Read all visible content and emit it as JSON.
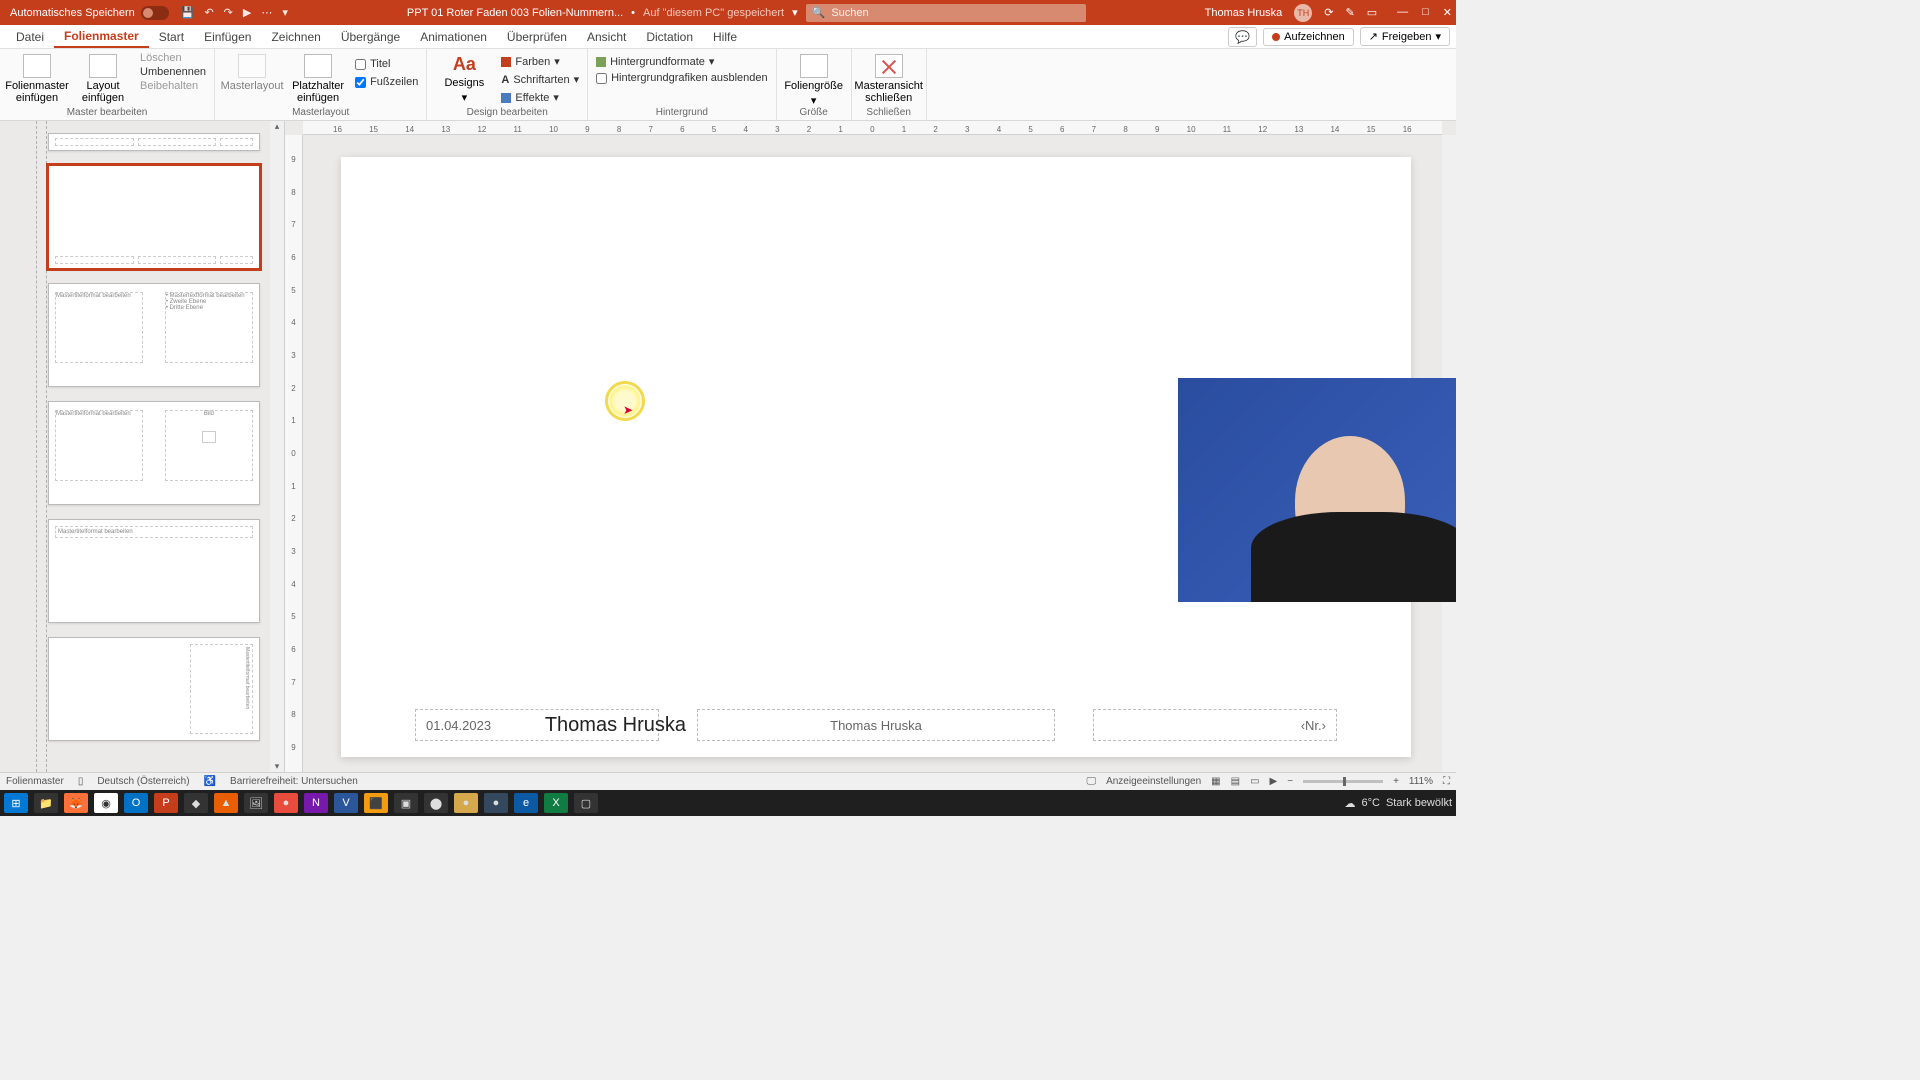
{
  "titlebar": {
    "autosave_label": "Automatisches Speichern",
    "filename": "PPT 01 Roter Faden 003 Folien-Nummern...",
    "saved_location": "Auf \"diesem PC\" gespeichert",
    "search_placeholder": "Suchen",
    "user_name": "Thomas Hruska",
    "user_initials": "TH"
  },
  "tabs": {
    "items": [
      "Datei",
      "Folienmaster",
      "Start",
      "Einfügen",
      "Zeichnen",
      "Übergänge",
      "Animationen",
      "Überprüfen",
      "Ansicht",
      "Dictation",
      "Hilfe"
    ],
    "active_index": 1,
    "record_label": "Aufzeichnen",
    "share_label": "Freigeben"
  },
  "ribbon": {
    "group_edit": {
      "insert_master": "Folienmaster einfügen",
      "insert_layout": "Layout einfügen",
      "delete": "Löschen",
      "rename": "Umbenennen",
      "preserve": "Beibehalten",
      "label": "Master bearbeiten"
    },
    "group_layout": {
      "master_layout": "Masterlayout",
      "placeholder": "Platzhalter einfügen",
      "title_chk": "Titel",
      "footer_chk": "Fußzeilen",
      "label": "Masterlayout"
    },
    "group_design": {
      "designs": "Designs",
      "colors": "Farben",
      "fonts": "Schriftarten",
      "effects": "Effekte",
      "label": "Design bearbeiten"
    },
    "group_bg": {
      "bg_formats": "Hintergrundformate",
      "hide_bg": "Hintergrundgrafiken ausblenden",
      "label": "Hintergrund"
    },
    "group_size": {
      "size": "Foliengröße",
      "label": "Größe"
    },
    "group_close": {
      "close": "Masteransicht schließen",
      "label": "Schließen"
    }
  },
  "ruler_h": [
    "16",
    "15",
    "14",
    "13",
    "12",
    "11",
    "10",
    "9",
    "8",
    "7",
    "6",
    "5",
    "4",
    "3",
    "2",
    "1",
    "0",
    "1",
    "2",
    "3",
    "4",
    "5",
    "6",
    "7",
    "8",
    "9",
    "10",
    "11",
    "12",
    "13",
    "14",
    "15",
    "16"
  ],
  "ruler_v": [
    "9",
    "8",
    "7",
    "6",
    "5",
    "4",
    "3",
    "2",
    "1",
    "0",
    "1",
    "2",
    "3",
    "4",
    "5",
    "6",
    "7",
    "8",
    "9"
  ],
  "thumbnails": {
    "items": [
      {
        "kind": "footer-strip"
      },
      {
        "kind": "blank-selected"
      },
      {
        "kind": "two-content",
        "left_text": "Mastertitelformat bearbeiten",
        "right_text": "• Mastertextformat bearbeiten\n  • Zweite Ebene\n    • Dritte Ebene"
      },
      {
        "kind": "pic-content",
        "left_text": "Mastertitelformat bearbeiten",
        "right_text": "Bild"
      },
      {
        "kind": "section",
        "title": "Mastertitelformat bearbeiten"
      },
      {
        "kind": "vertical-text",
        "title": "Mastertitelformat bearbeiten"
      }
    ]
  },
  "slide": {
    "date": "01.04.2023",
    "author_big": "Thomas Hruska",
    "footer_center": "Thomas Hruska",
    "slide_number": "‹Nr.›"
  },
  "statusbar": {
    "mode": "Folienmaster",
    "language": "Deutsch (Österreich)",
    "accessibility": "Barrierefreiheit: Untersuchen",
    "display_settings": "Anzeigeeinstellungen",
    "zoom": "111%"
  },
  "taskbar": {
    "weather_temp": "6°C",
    "weather_desc": "Stark bewölkt"
  }
}
